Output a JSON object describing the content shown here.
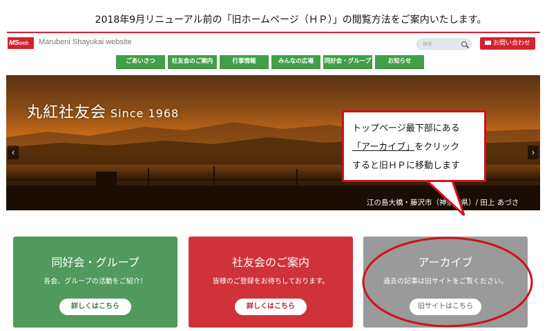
{
  "notice": "2018年9月リニューアル前の「旧ホームページ（ＨＰ）」の閲覧方法をご案内いたします。",
  "header": {
    "logo_ms": "MS",
    "logo_web": "web",
    "site_name": "Marubeni Shayukai website",
    "search_placeholder": "検索",
    "contact_label": "お問い合わせ"
  },
  "nav": [
    "ごあいさつ",
    "社友会のご案内",
    "行事情報",
    "みんなの広場",
    "同好会・グループ",
    "お知らせ"
  ],
  "hero": {
    "title": "丸紅社友会",
    "since": "Since 1968",
    "caption": "江の島大橋・藤沢市（神奈川県）/ 田上 あづさ",
    "prev": "‹",
    "next": "›"
  },
  "callout": {
    "line1": "トップページ最下部にある",
    "line2_link": "「アーカイブ」",
    "line2_rest": "をクリック",
    "line3": "すると旧ＨＰに移動します"
  },
  "cards": [
    {
      "title": "同好会・グループ",
      "text": "各会、グループの活動をご紹介！",
      "button": "詳しくはこちら"
    },
    {
      "title": "社友会のご案内",
      "text": "皆様のご登録をお待ちしております。",
      "button": "詳しくはこちら"
    },
    {
      "title": "アーカイブ",
      "text": "過去の記事は旧サイトをご覧ください。",
      "button": "旧サイトはこちら"
    }
  ],
  "colors": {
    "brand_red": "#d62130",
    "nav_green": "#3fa048",
    "highlight_red": "#d01020"
  }
}
